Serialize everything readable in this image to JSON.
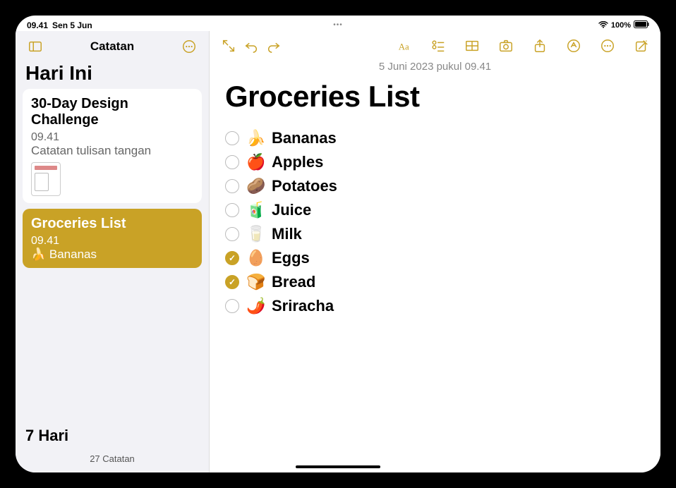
{
  "status": {
    "time": "09.41",
    "date": "Sen 5 Jun",
    "wifi": "wifi-icon",
    "battery_pct": "100%"
  },
  "sidebar": {
    "app_title": "Catatan",
    "section_today": "Hari Ini",
    "section_7days": "7 Hari",
    "footer": "27 Catatan",
    "notes": [
      {
        "title": "30-Day Design Challenge",
        "time": "09.41",
        "preview": "Catatan tulisan tangan",
        "selected": false,
        "has_thumb": true
      },
      {
        "title": "Groceries List",
        "time": "09.41",
        "preview": "🍌 Bananas",
        "selected": true,
        "has_thumb": false
      }
    ]
  },
  "editor": {
    "date_line": "5 Juni 2023 pukul 09.41",
    "title": "Groceries List",
    "items": [
      {
        "emoji": "🍌",
        "text": "Bananas",
        "checked": false
      },
      {
        "emoji": "🍎",
        "text": "Apples",
        "checked": false
      },
      {
        "emoji": "🥔",
        "text": "Potatoes",
        "checked": false
      },
      {
        "emoji": "🧃",
        "text": "Juice",
        "checked": false
      },
      {
        "emoji": "🥛",
        "text": "Milk",
        "checked": false
      },
      {
        "emoji": "🥚",
        "text": "Eggs",
        "checked": true
      },
      {
        "emoji": "🍞",
        "text": "Bread",
        "checked": true
      },
      {
        "emoji": "🌶️",
        "text": "Sriracha",
        "checked": false
      }
    ]
  }
}
